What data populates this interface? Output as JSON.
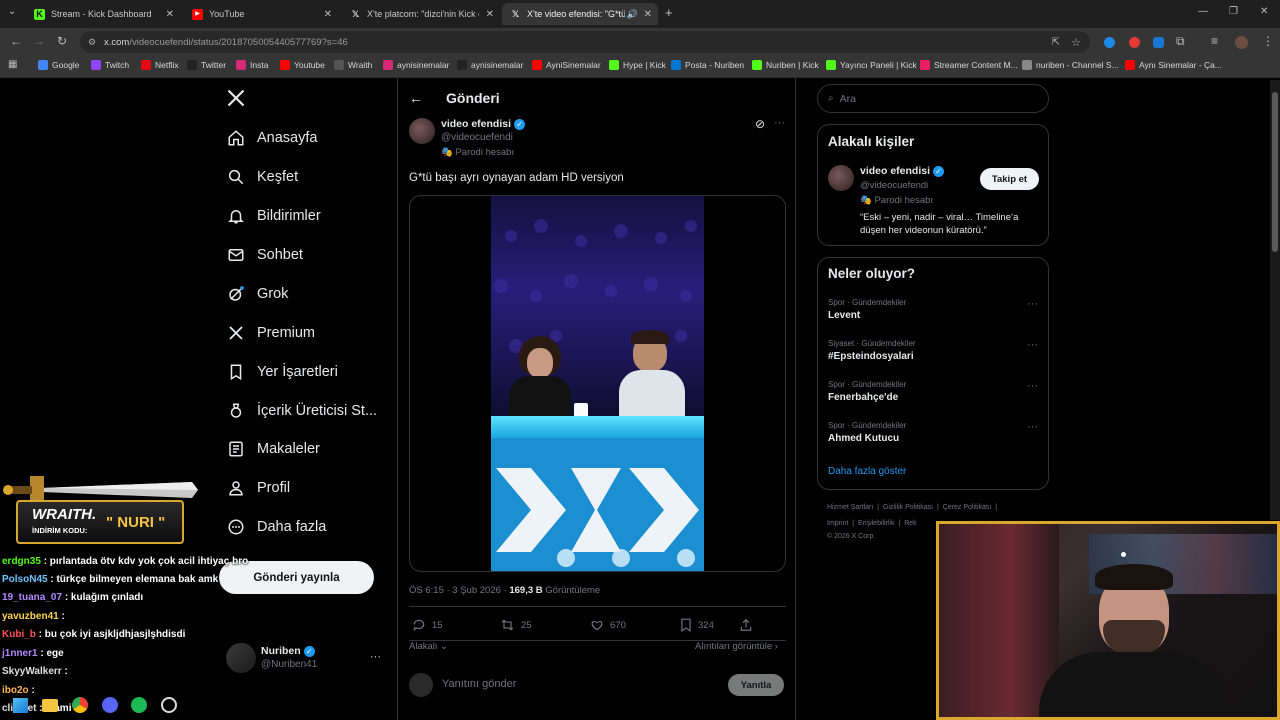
{
  "browser": {
    "tabs": [
      {
        "label": "Stream - Kick Dashboard",
        "icon": "kick-icon"
      },
      {
        "label": "YouTube",
        "icon": "youtube-icon"
      },
      {
        "label": "X'te platcom: \"dizci'nin Kick can",
        "icon": "x-icon"
      },
      {
        "label": "X'te video efendisi: \"G*tü ba",
        "icon": "x-icon"
      }
    ],
    "url_host": "x.com",
    "url_path": "/videocuefendi/status/2018705005440577769?s=46",
    "bookmarks": [
      {
        "label": "Google",
        "color": "#4285f4"
      },
      {
        "label": "Twitch",
        "color": "#9146ff"
      },
      {
        "label": "Netflix",
        "color": "#e50914"
      },
      {
        "label": "Twitter",
        "color": "#222222"
      },
      {
        "label": "Insta",
        "color": "#d62976"
      },
      {
        "label": "Youtube",
        "color": "#ff0000"
      },
      {
        "label": "Wraith",
        "color": "#555555"
      },
      {
        "label": "aynisinemalar",
        "color": "#d62976"
      },
      {
        "label": "aynisinemalar",
        "color": "#222222"
      },
      {
        "label": "AyniSinemalar",
        "color": "#ff0000"
      },
      {
        "label": "Hype | Kick",
        "color": "#53fc18"
      },
      {
        "label": "Posta - Nuriben",
        "color": "#0078d4"
      },
      {
        "label": "Nuriben | Kick",
        "color": "#53fc18"
      },
      {
        "label": "Yayıncı Paneli | Kick",
        "color": "#53fc18"
      },
      {
        "label": "Streamer Content M...",
        "color": "#e91e63"
      },
      {
        "label": "nuriben - Channel S...",
        "color": "#888888"
      },
      {
        "label": "Aynı Sinemalar - Ça...",
        "color": "#ff0000"
      }
    ]
  },
  "nav": {
    "items": [
      {
        "label": "Anasayfa",
        "icon": "home-icon"
      },
      {
        "label": "Keşfet",
        "icon": "search-icon"
      },
      {
        "label": "Bildirimler",
        "icon": "bell-icon"
      },
      {
        "label": "Sohbet",
        "icon": "mail-icon"
      },
      {
        "label": "Grok",
        "icon": "grok-icon"
      },
      {
        "label": "Premium",
        "icon": "x-logo-icon"
      },
      {
        "label": "Yer İşaretleri",
        "icon": "bookmark-icon"
      },
      {
        "label": "İçerik Üreticisi St...",
        "icon": "creator-icon"
      },
      {
        "label": "Makaleler",
        "icon": "article-icon"
      },
      {
        "label": "Profil",
        "icon": "person-icon"
      },
      {
        "label": "Daha fazla",
        "icon": "more-circle-icon"
      }
    ],
    "post_button": "Gönderi yayınla",
    "account_name": "Nuriben",
    "account_handle": "@Nuriben41"
  },
  "post": {
    "header": "Gönderi",
    "author_name": "video efendisi",
    "author_handle": "@videocuefendi",
    "parody_label": "Parodi hesabı",
    "text": "G*tü başı ayrı oynayan adam HD versiyon",
    "time": "ÖS 6:15 · 3 Şub 2026 ·",
    "views": "169,3 B",
    "views_label": "Görüntüleme",
    "replies": "15",
    "reposts": "25",
    "likes": "670",
    "bookmarks": "324",
    "relevance": "Alakalı",
    "quotes_link": "Alıntıları görüntüle",
    "reply_placeholder": "Yanıtını gönder",
    "reply_button": "Yanıtla"
  },
  "sidebar": {
    "search_placeholder": "Ara",
    "related_title": "Alakalı kişiler",
    "related_name": "video efendisi",
    "related_handle": "@videocuefendi",
    "related_parody": "Parodi hesabı",
    "related_bio": "“Eski – yeni, nadir – viral… Timeline’a düşen her videonun küratörü.”",
    "follow_button": "Takip et",
    "trends_title": "Neler oluyor?",
    "trends": [
      {
        "category": "Spor · Gündemdekiler",
        "title": "Levent"
      },
      {
        "category": "Siyaset · Gündemdekiler",
        "title": "#Epsteindosyalari"
      },
      {
        "category": "Spor · Gündemdekiler",
        "title": "Fenerbahçe'de"
      },
      {
        "category": "Spor · Gündemdekiler",
        "title": "Ahmed Kutucu"
      }
    ],
    "show_more": "Daha fazla göster",
    "footer": [
      "Hizmet Şartları",
      "Gizlilik Politikası",
      "Çerez Politikası",
      "Imprint",
      "Erişilebilirlik",
      "Rek",
      "© 2026 X Corp."
    ]
  },
  "overlay": {
    "banner_title": "WRAITH.",
    "banner_sub": "İNDİRİM KODU:",
    "banner_code": "\" NURI \"",
    "chat": [
      {
        "user": "erdgn35",
        "msg": ": pırlantada ötv kdv yok çok acil ihtiyaç bro",
        "color": "#53fc18"
      },
      {
        "user": "PolsoN45",
        "msg": ": türkçe bilmeyen elemana bak amk",
        "color": "#6ec6ff"
      },
      {
        "user": "19_tuana_07",
        "msg": ": kulağım çınladı",
        "color": "#b388ff"
      },
      {
        "user": "yavuzben41",
        "msg": ":",
        "color": "#ffd54f"
      },
      {
        "user": "Kubi_b",
        "msg": ": bu çok iyi asjkljdhjasjlşhdisdi",
        "color": "#ff5252"
      },
      {
        "user": "j1nner1",
        "msg": ": ege",
        "color": "#b388ff"
      },
      {
        "user": "SkyyWalkerr",
        "msg": ":",
        "color": "#e0e0e0"
      },
      {
        "user": "ibo2o",
        "msg": ":",
        "color": "#ffb74d"
      },
      {
        "user": "clismet",
        "msg": ": mami ad",
        "color": "#e0e0e0"
      }
    ]
  },
  "colors": {
    "x_blue": "#1d9bf0",
    "accent_gold": "#d9a62e",
    "kick_green": "#53fc18"
  }
}
